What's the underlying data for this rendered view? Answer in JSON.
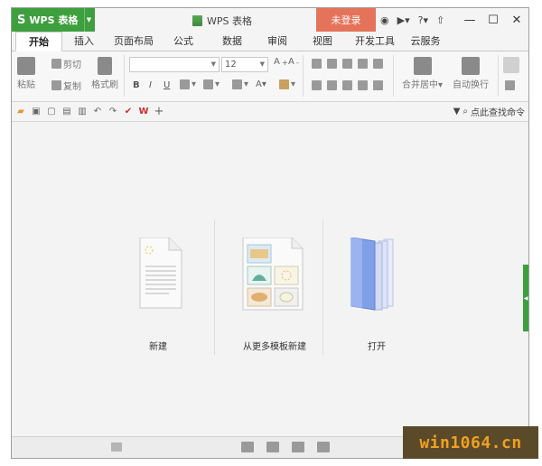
{
  "titlebar": {
    "app_name": "WPS 表格",
    "app_logo": "S",
    "doc_title": "WPS 表格",
    "login_label": "未登录",
    "help_label": "?",
    "icons": [
      "skin-icon",
      "user-menu-icon",
      "help-icon",
      "share-icon"
    ],
    "window_controls": [
      "minimize-icon",
      "maximize-icon",
      "close-icon"
    ]
  },
  "tabs": [
    {
      "label": "开始",
      "active": true
    },
    {
      "label": "插入"
    },
    {
      "label": "页面布局"
    },
    {
      "label": "公式"
    },
    {
      "label": "数据"
    },
    {
      "label": "审阅"
    },
    {
      "label": "视图"
    },
    {
      "label": "开发工具"
    },
    {
      "label": "云服务"
    }
  ],
  "ribbon": {
    "paste_label": "粘贴",
    "cut_label": "剪切",
    "copy_label": "复制",
    "format_painter_label": "格式刷",
    "font_name": "",
    "font_size": "12",
    "bold": "B",
    "italic": "I",
    "underline": "U",
    "merge_label": "合并居中",
    "wrap_label": "自动换行"
  },
  "quick_access": {
    "search_label": "点此查找命令"
  },
  "start": {
    "new_label": "新建",
    "template_label": "从更多模板新建",
    "open_label": "打开"
  },
  "watermark": "win1064.cn"
}
